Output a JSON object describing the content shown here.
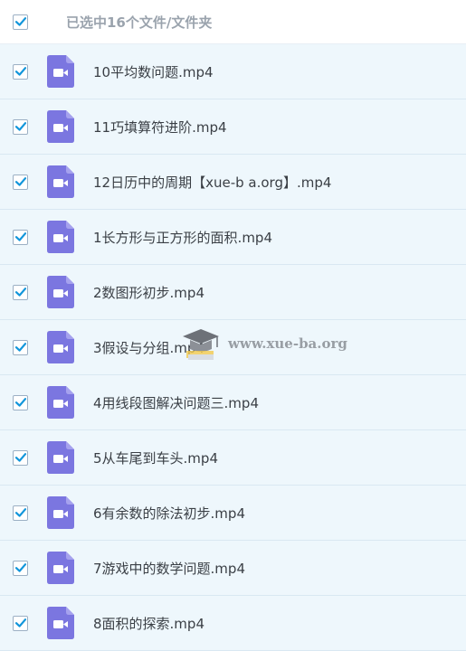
{
  "header": {
    "title": "已选中16个文件/文件夹"
  },
  "files": [
    {
      "name": "10平均数问题.mp4",
      "checked": true
    },
    {
      "name": "11巧填算符进阶.mp4",
      "checked": true
    },
    {
      "name": "12日历中的周期【xue-b a.org】.mp4",
      "checked": true
    },
    {
      "name": "1长方形与正方形的面积.mp4",
      "checked": true
    },
    {
      "name": "2数图形初步.mp4",
      "checked": true
    },
    {
      "name": "3假设与分组.mp4",
      "checked": true
    },
    {
      "name": "4用线段图解决问题三.mp4",
      "checked": true
    },
    {
      "name": "5从车尾到车头.mp4",
      "checked": true
    },
    {
      "name": "6有余数的除法初步.mp4",
      "checked": true
    },
    {
      "name": "7游戏中的数学问题.mp4",
      "checked": true
    },
    {
      "name": "8面积的探索.mp4",
      "checked": true
    }
  ],
  "watermark": {
    "text": "www.xue-ba.org"
  },
  "colors": {
    "checkmark": "#1296db",
    "video_icon": "#7b76e0",
    "background": "#eef7fc"
  },
  "icons": {
    "checkbox": "checkmark-icon",
    "file": "video-file-icon",
    "watermark": "graduation-cap-icon"
  }
}
